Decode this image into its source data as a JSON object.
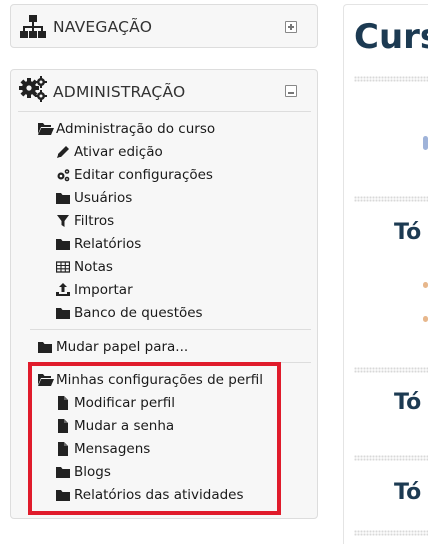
{
  "navigation": {
    "title": "NAVEGAÇÃO"
  },
  "administration": {
    "title": "ADMINISTRAÇÃO",
    "course_admin": {
      "label": "Administração do curso",
      "items": [
        {
          "label": "Ativar edição",
          "icon": "pencil-icon"
        },
        {
          "label": "Editar configurações",
          "icon": "gears-icon"
        },
        {
          "label": "Usuários",
          "icon": "folder-icon"
        },
        {
          "label": "Filtros",
          "icon": "filter-icon"
        },
        {
          "label": "Relatórios",
          "icon": "folder-icon"
        },
        {
          "label": "Notas",
          "icon": "table-icon"
        },
        {
          "label": "Importar",
          "icon": "upload-icon"
        },
        {
          "label": "Banco de questões",
          "icon": "folder-icon"
        }
      ]
    },
    "switch_role": {
      "label": "Mudar papel para..."
    },
    "profile_settings": {
      "label": "Minhas configurações de perfil",
      "items": [
        {
          "label": "Modificar perfil",
          "icon": "file-icon"
        },
        {
          "label": "Mudar a senha",
          "icon": "file-icon"
        },
        {
          "label": "Mensagens",
          "icon": "file-icon"
        },
        {
          "label": "Blogs",
          "icon": "folder-icon"
        },
        {
          "label": "Relatórios das atividades",
          "icon": "folder-icon"
        }
      ]
    }
  },
  "main": {
    "title": "Curs",
    "topics": [
      "Tó",
      "Tó",
      "Tó"
    ]
  },
  "colors": {
    "highlight": "#e01b2b",
    "heading": "#1c3a52",
    "block_bg": "#f7f7f7"
  }
}
